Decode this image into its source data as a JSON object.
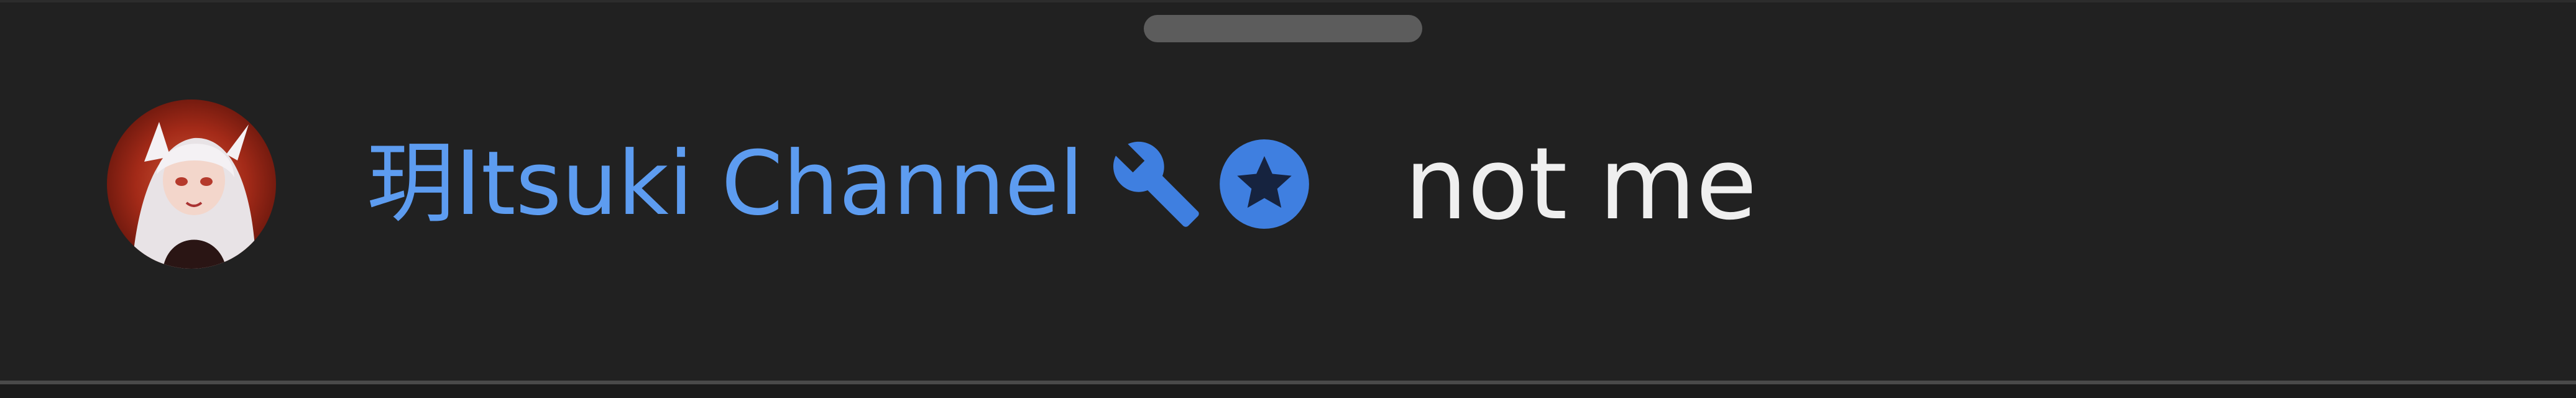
{
  "comment": {
    "author": "玥Itsuki Channel",
    "message": "not me",
    "badges": [
      "wrench-icon",
      "star-icon"
    ]
  },
  "colors": {
    "background": "#212121",
    "author": "#5d9cf0",
    "badge": "#3f7fe0",
    "message": "#efefef",
    "handle": "#5c5c5c"
  }
}
